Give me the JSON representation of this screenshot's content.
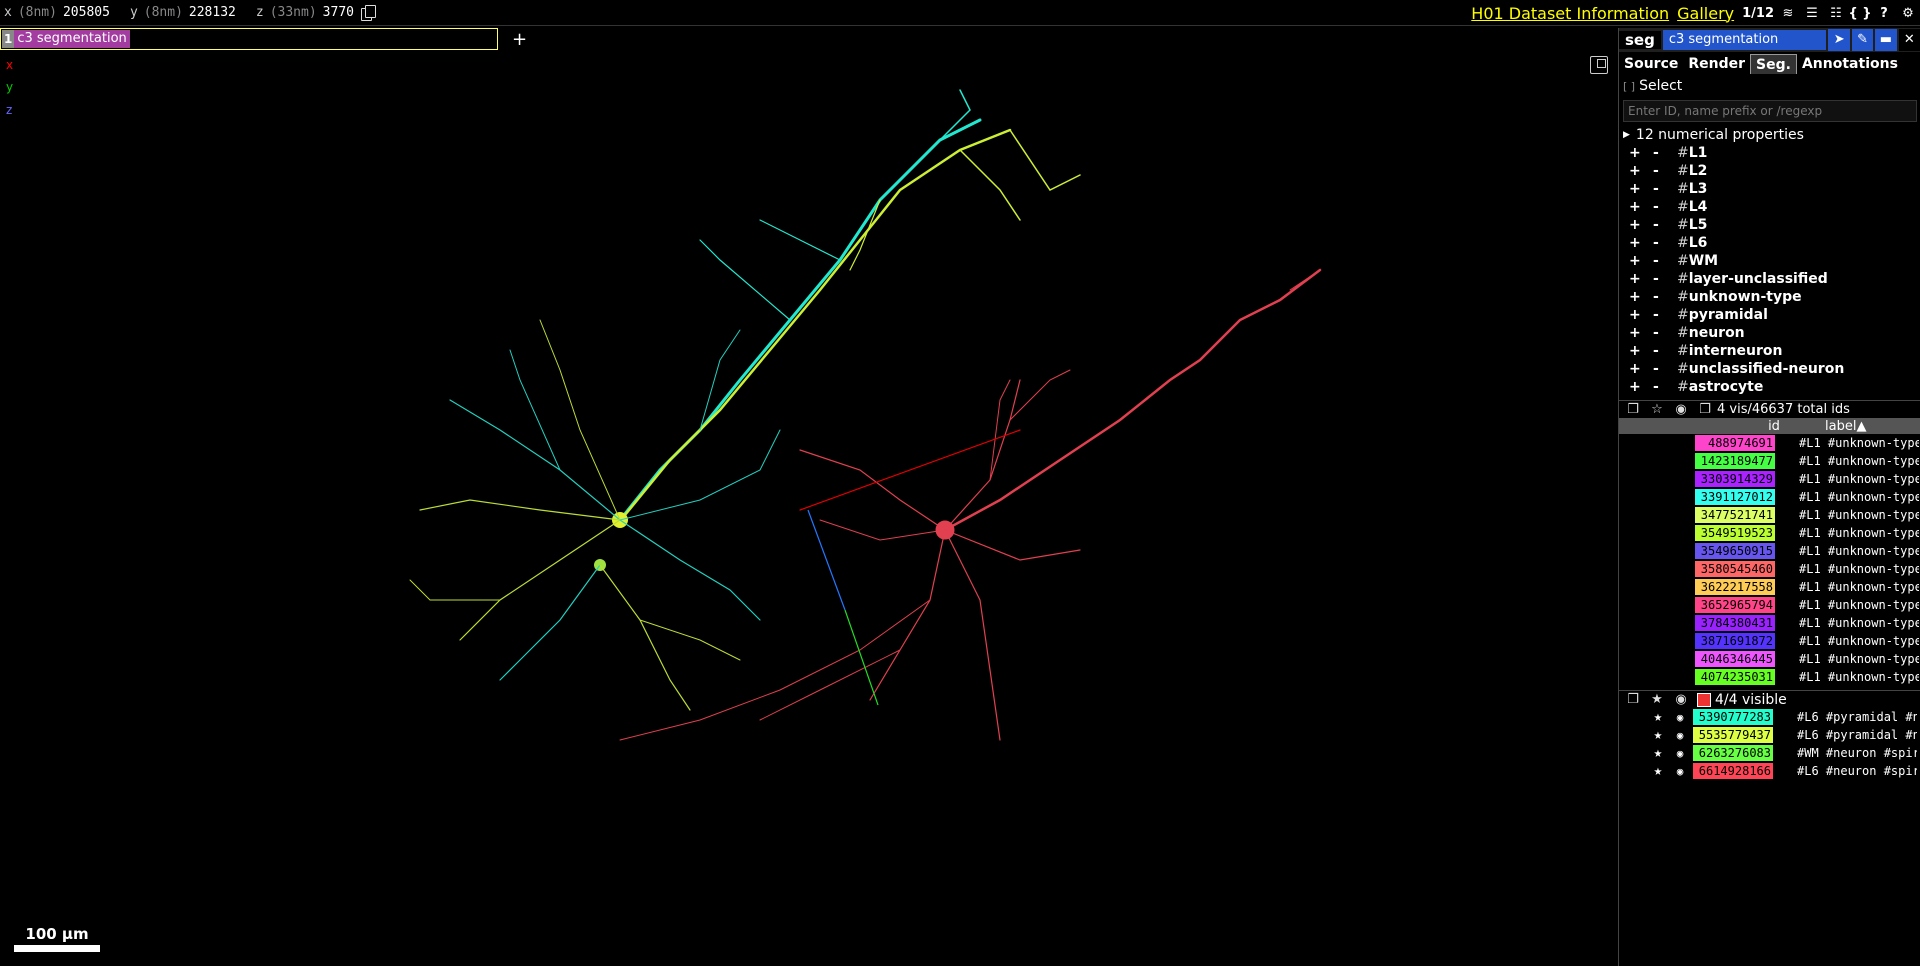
{
  "topbar": {
    "x": {
      "label": "x",
      "unit": "(8nm)",
      "value": "205805"
    },
    "y": {
      "label": "y",
      "unit": "(8nm)",
      "value": "228132"
    },
    "z": {
      "label": "z",
      "unit": "(33nm)",
      "value": "3770"
    },
    "dataset_link": "H01 Dataset Information",
    "gallery_link": "Gallery",
    "layer_count": "1/12",
    "accent": "#ffff00"
  },
  "layer": {
    "number": "1",
    "name": "c3 segmentation",
    "color": "#a23ca0",
    "add": "+"
  },
  "axes": {
    "x": "x",
    "y": "y",
    "z": "z"
  },
  "scalebar": {
    "label": "100 µm"
  },
  "panel": {
    "tag": "seg",
    "title": "c3 segmentation",
    "tabs": [
      "Source",
      "Render",
      "Seg.",
      "Annotations"
    ],
    "active_tab": "Seg.",
    "select": {
      "check": "[ ]",
      "label": "Select"
    },
    "filter_placeholder": "Enter ID, name prefix or /regexp",
    "numerical_properties": "12 numerical properties",
    "tags": [
      "L1",
      "L2",
      "L3",
      "L4",
      "L5",
      "L6",
      "WM",
      "layer-unclassified",
      "unknown-type",
      "pyramidal",
      "neuron",
      "interneuron",
      "unclassified-neuron",
      "astrocyte"
    ],
    "total_ids": "4 vis/46637 total ids",
    "columns": {
      "id": "id",
      "label": "label▲"
    },
    "ids": [
      {
        "id": "488974691",
        "label": "#L1 #unknown-type",
        "color": "#ff44cc"
      },
      {
        "id": "1423189477",
        "label": "#L1 #unknown-type",
        "color": "#44ff44"
      },
      {
        "id": "3303914329",
        "label": "#L1 #unknown-type",
        "color": "#aa22ff"
      },
      {
        "id": "3391127012",
        "label": "#L1 #unknown-type",
        "color": "#33ffee"
      },
      {
        "id": "3477521741",
        "label": "#L1 #unknown-type",
        "color": "#ddff66"
      },
      {
        "id": "3549519523",
        "label": "#L1 #unknown-type",
        "color": "#bbff33"
      },
      {
        "id": "3549650915",
        "label": "#L1 #unknown-type",
        "color": "#6655ee"
      },
      {
        "id": "3580545460",
        "label": "#L1 #unknown-type",
        "color": "#ff6666"
      },
      {
        "id": "3622217558",
        "label": "#L1 #unknown-type",
        "color": "#ffcc55"
      },
      {
        "id": "3652965794",
        "label": "#L1 #unknown-type",
        "color": "#ff4488"
      },
      {
        "id": "3784380431",
        "label": "#L1 #unknown-type",
        "color": "#9922ff"
      },
      {
        "id": "3871691872",
        "label": "#L1 #unknown-type",
        "color": "#5533ff"
      },
      {
        "id": "4046346445",
        "label": "#L1 #unknown-type",
        "color": "#ee55ff"
      },
      {
        "id": "4074235031",
        "label": "#L1 #unknown-type",
        "color": "#66ff22"
      }
    ],
    "visible_count": "4/4 visible",
    "visible": [
      {
        "id": "5390777283",
        "label": "#L6 #pyramidal #n",
        "color": "#22ffcc"
      },
      {
        "id": "5535779437",
        "label": "#L6 #pyramidal #n",
        "color": "#ddff44"
      },
      {
        "id": "6263276083",
        "label": "#WM #neuron #spir",
        "color": "#66ff44"
      },
      {
        "id": "6614928166",
        "label": "#L6 #neuron #spir",
        "color": "#ff4455"
      }
    ]
  }
}
